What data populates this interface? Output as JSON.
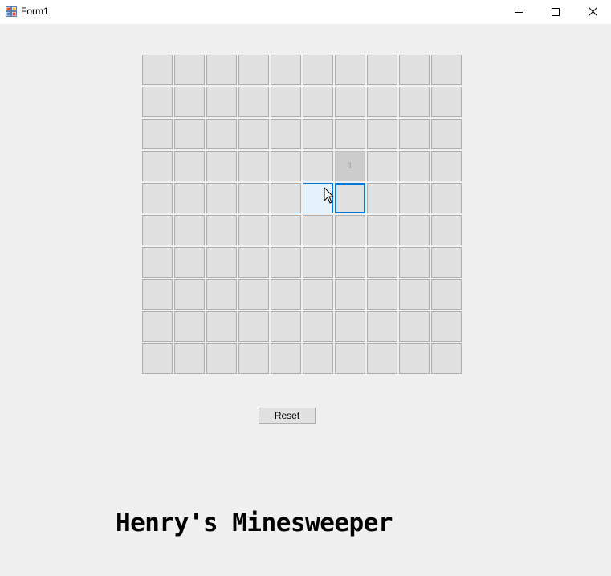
{
  "window": {
    "title": "Form1",
    "controls": {
      "minimize": "minimize-icon",
      "maximize": "maximize-icon",
      "close": "close-icon"
    }
  },
  "board": {
    "rows": 10,
    "cols": 10,
    "cell_color": "#e1e1e1",
    "revealed_color": "#cccccc",
    "hover_color": "#e5f1fb",
    "focus_color": "#0078d7",
    "revealed": [
      {
        "row": 3,
        "col": 6,
        "value": "1"
      }
    ],
    "hovered": {
      "row": 4,
      "col": 5
    },
    "focused": {
      "row": 4,
      "col": 6
    }
  },
  "reset": {
    "label": "Reset"
  },
  "heading": {
    "text": "Henry's Minesweeper"
  }
}
